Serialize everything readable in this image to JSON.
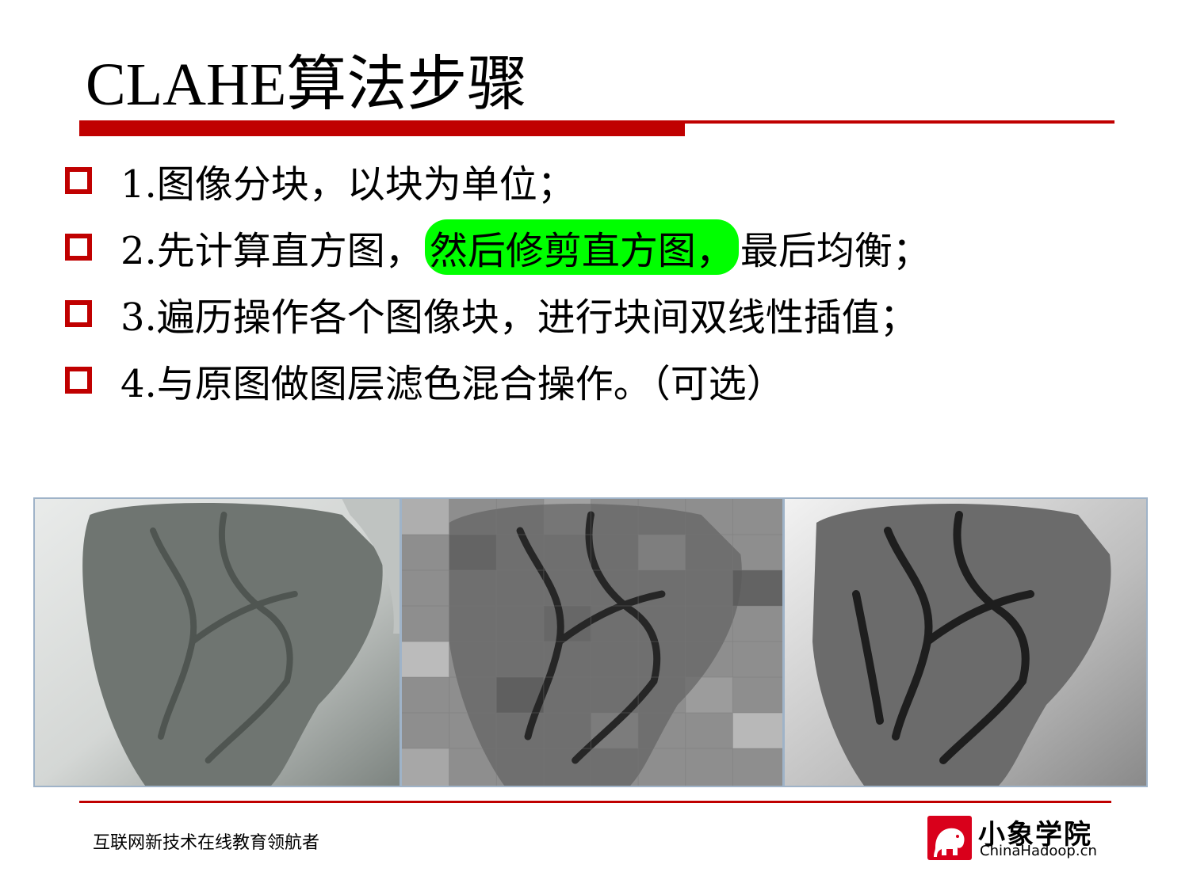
{
  "slide": {
    "title": "CLAHE算法步骤",
    "steps": [
      {
        "text": "1.图像分块，以块为单位；"
      },
      {
        "before": "2.先计算直方图，",
        "highlight": "然后修剪直方图，",
        "after": "最后均衡；"
      },
      {
        "text": "3.遍历操作各个图像块，进行块间双线性插值；"
      },
      {
        "text": "4.与原图做图层滤色混合操作。（可选）"
      }
    ],
    "footer_text": "互联网新技术在线教育领航者",
    "logo": {
      "name_cn": "小象学院",
      "name_en": "ChinaHadoop.cn",
      "icon": "elephant-icon"
    },
    "colors": {
      "accent": "#c00000",
      "highlight": "#00ff00"
    }
  }
}
